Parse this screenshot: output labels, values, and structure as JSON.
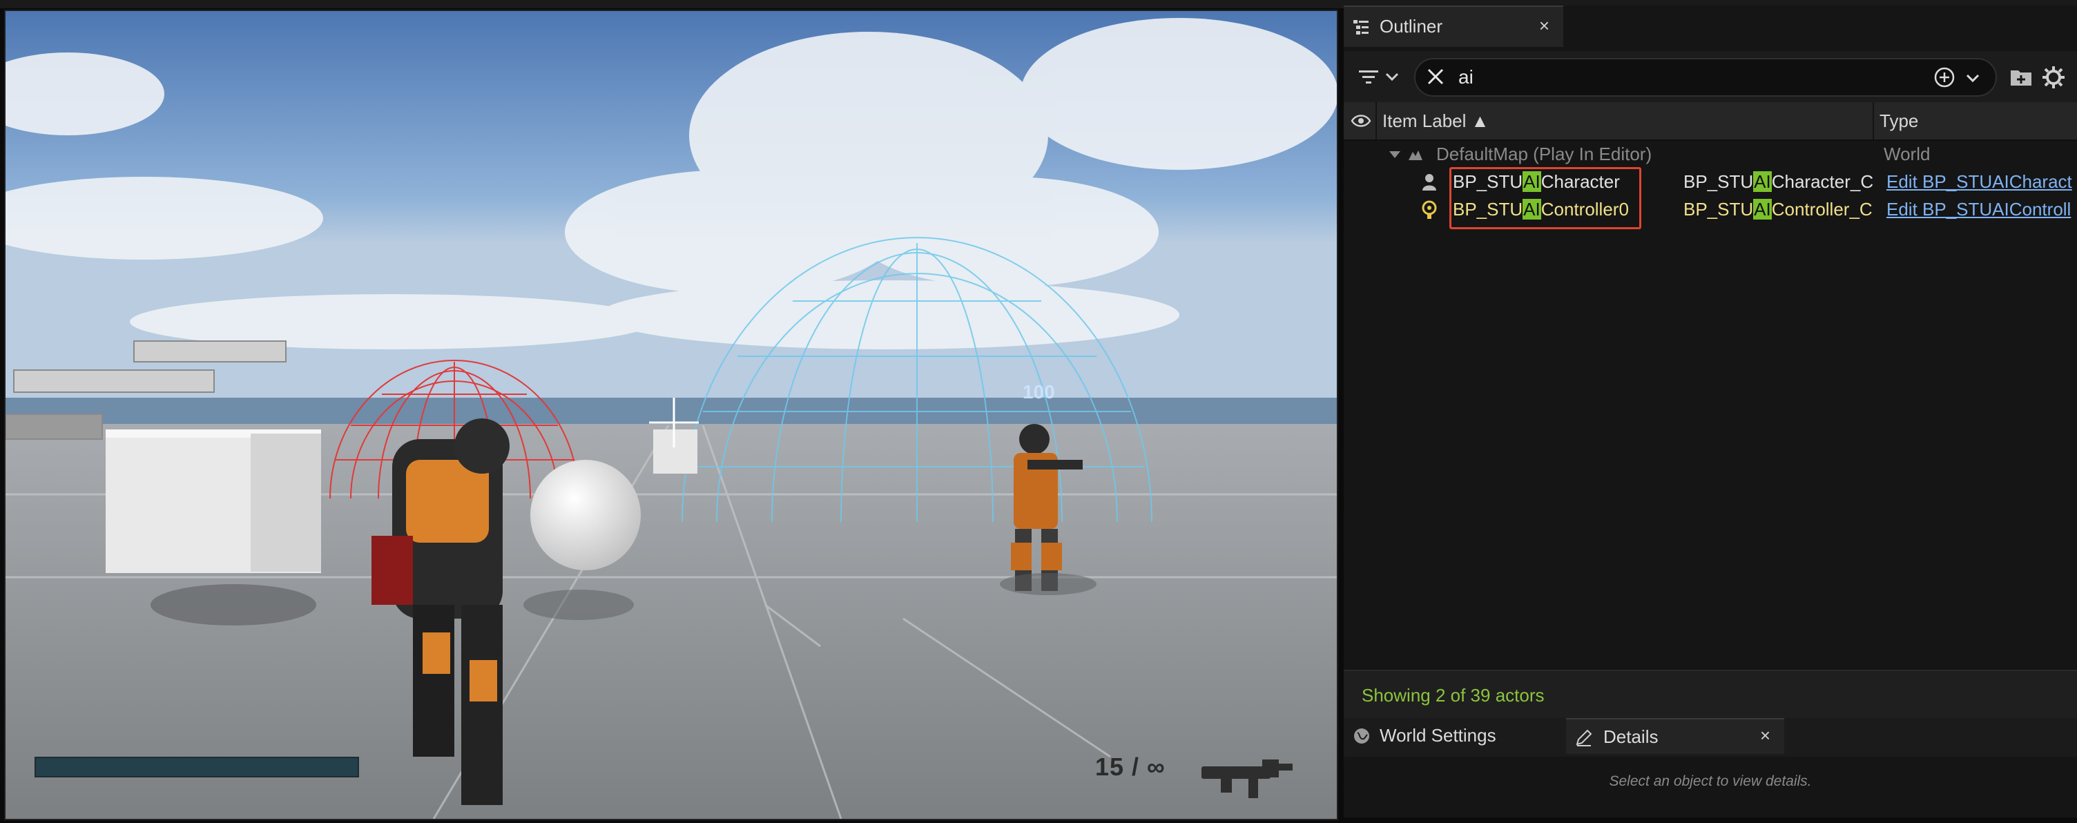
{
  "viewport": {
    "hud_number": "100",
    "ammo": "15 / ∞"
  },
  "outliner": {
    "tab_label": "Outliner",
    "tab_close": "×",
    "search_value": "ai",
    "columns": {
      "label": "Item Label ▲",
      "type": "Type"
    },
    "rows": [
      {
        "indent": 1,
        "label": "DefaultMap (Play In Editor)",
        "type": "World",
        "icon": "world-map-icon"
      },
      {
        "indent": 2,
        "label_pre": "BP_STU",
        "label_match": "AI",
        "label_post": "Character",
        "class_pre": "BP_STU",
        "class_match": "AI",
        "class_post": "Character_C",
        "edit": "Edit BP_STUAICharact",
        "icon": "character-icon"
      },
      {
        "indent": 2,
        "label_pre": "BP_STU",
        "label_match": "AI",
        "label_post": "Controller0",
        "class_pre": "BP_STU",
        "class_match": "AI",
        "class_post": "Controller_C",
        "edit": "Edit BP_STUAIControll",
        "icon": "controller-icon"
      }
    ],
    "status": "Showing 2 of 39 actors"
  },
  "details": {
    "tab_world": "World Settings",
    "tab_details": "Details",
    "tab_close": "×",
    "empty_text": "Select an object to view details."
  },
  "colors": {
    "accent_match": "#7ac12c",
    "highlight_box": "#e0452e",
    "link": "#7fb3f2",
    "status_green": "#8cc43e"
  }
}
